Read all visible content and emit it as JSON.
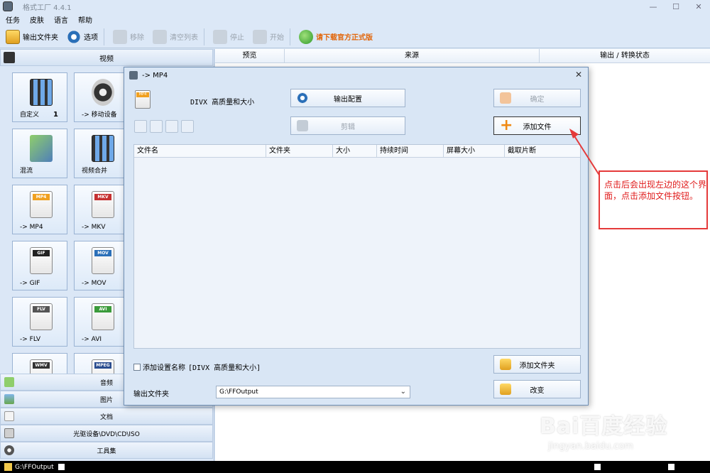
{
  "window": {
    "title": "格式工厂 4.4.1"
  },
  "menu": {
    "items": [
      "任务",
      "皮肤",
      "语言",
      "帮助"
    ]
  },
  "toolbar": {
    "output_folder": "输出文件夹",
    "options": "选项",
    "remove": "移除",
    "clear_list": "清空列表",
    "stop": "停止",
    "start": "开始",
    "promo": "请下载官方正式版"
  },
  "left": {
    "video_header": "视频",
    "tiles": [
      {
        "label": "自定义",
        "num": "1"
      },
      {
        "label": "-> 移动设备",
        "num": ""
      },
      {
        "label": "混流",
        "num": ""
      },
      {
        "label": "视频合并",
        "num": ""
      },
      {
        "label": "-> MP4",
        "num": "",
        "badge": "MP4"
      },
      {
        "label": "-> MKV",
        "num": "",
        "badge": "MKV"
      },
      {
        "label": "-> GIF",
        "num": "",
        "badge": "GIF"
      },
      {
        "label": "-> MOV",
        "num": "",
        "badge": "MOV"
      },
      {
        "label": "-> FLV",
        "num": "",
        "badge": "FLV"
      },
      {
        "label": "-> AVI",
        "num": "",
        "badge": "AVI"
      },
      {
        "label": "",
        "num": "",
        "badge": "WMV"
      },
      {
        "label": "",
        "num": "",
        "badge": "MPEG"
      }
    ],
    "categories": [
      "音频",
      "图片",
      "文档",
      "光驱设备\\DVD\\CD\\ISO",
      "工具集"
    ]
  },
  "list": {
    "columns": [
      "预览",
      "来源",
      "输出 / 转换状态"
    ]
  },
  "status": {
    "path": "G:\\FFOutput"
  },
  "dialog": {
    "title": "-> MP4",
    "preset": "DIVX 高质量和大小",
    "output_config": "输出配置",
    "ok": "确定",
    "clip": "剪辑",
    "add_file": "添加文件",
    "fmt_badge": "MP4",
    "columns": [
      "文件名",
      "文件夹",
      "大小",
      "持续时间",
      "屏幕大小",
      "截取片断"
    ],
    "add_setting_name": "添加设置名称",
    "add_setting_preset": "[DIVX 高质量和大小]",
    "add_folder": "添加文件夹",
    "output_folder_label": "输出文件夹",
    "output_folder_value": "G:\\FFOutput",
    "change": "改变"
  },
  "annotation": {
    "text": "点击后会出现左边的这个界面，点击添加文件按钮。",
    "color": "#e01b1b"
  },
  "watermark": {
    "logo": "Bai百度经验",
    "url": "jingyan.baidu.com"
  },
  "colors": {
    "accent": "#2a6fb8",
    "promo": "#e2660b",
    "annotation": "#e53a3a"
  }
}
